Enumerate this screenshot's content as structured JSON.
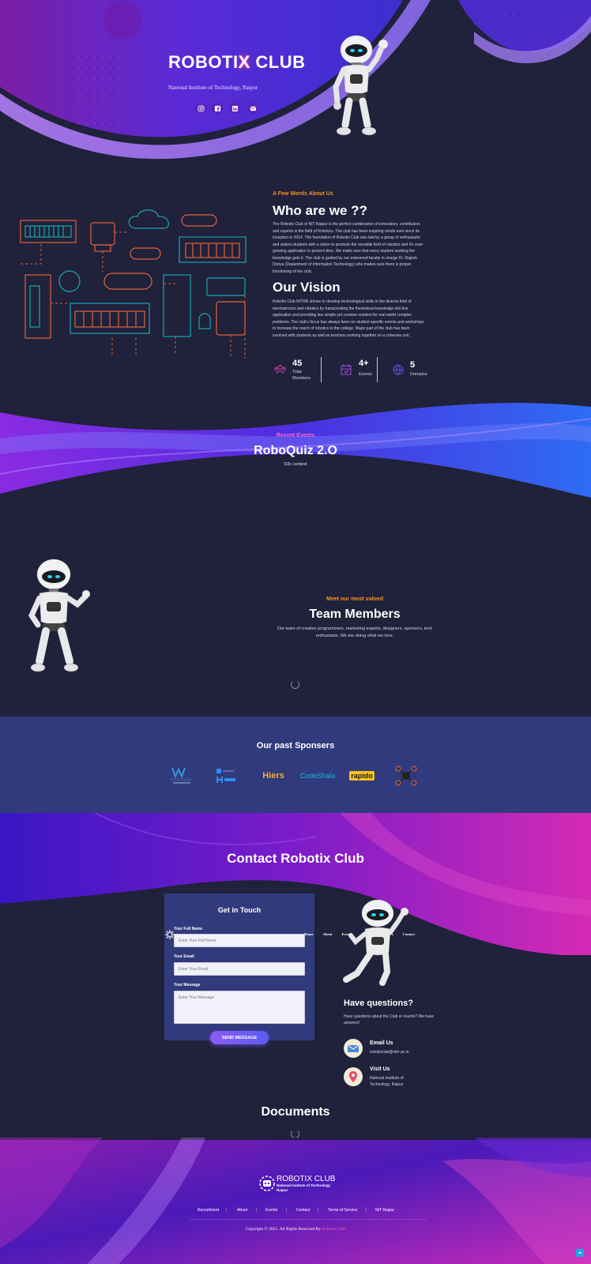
{
  "hero": {
    "title_prefix": "ROBOTI",
    "title_x": "X",
    "title_suffix": " CLUB",
    "subtitle": "National Institute of Technology, Raipur",
    "socials": [
      "instagram-icon",
      "facebook-icon",
      "linkedin-icon",
      "mail-icon"
    ]
  },
  "about": {
    "tag": "A Few Words About Us",
    "who_title": "Who are we ??",
    "who_text": "The Robotix Club of NIT Raipur is the perfect combination of innovators, contributors and experts in the field of Robotics. The club has been inspiring minds ever since its inception in 2014. The foundation of Robotix Club was laid by a group of enthusiastic and ardent students with a vision to promote the versatile field of robotics and it's ever-growing application in present time. We make sure that every student seeking the knowledge gets it. The club is guided by our esteemed faculty in charge Dr. Rajesh Doriya (Department of Information Technology) who makes sure there is proper functioning of the club.",
    "vision_title": "Our Vision",
    "vision_text": "Robotix Club NITRR strives to develop technological skills in the diverse field of mechatronics and robotics by transcending the theoretical knowledge into live application and providing live simple yet creative solution for real world complex problems. The club's focus has always been on student specific events and workshops to increase the reach of robotics in the college. Major part of the club has been involved with students as well as teachers working together so a cohesive unit.",
    "stats": [
      {
        "value": "45",
        "label_line1": "Total",
        "label_line2": "Members"
      },
      {
        "value": "4+",
        "label_line1": "Events",
        "label_line2": ""
      },
      {
        "value": "5",
        "label_line1": "Domains",
        "label_line2": ""
      }
    ]
  },
  "events": {
    "tag": "Recent Events",
    "title": "RoboQuiz 2.O",
    "subtitle": "D2c contest"
  },
  "team": {
    "tag": "Meet our most valued",
    "title": "Team Members",
    "text": "Our team of creative programmers, marketing experts, designers, sponsors, tech enthusiasts. We are doing what we love."
  },
  "sponsors": {
    "title": "Our past Sponsers",
    "logos": [
      "Wa",
      "Hoist",
      "Hiers",
      "CodeShala",
      "rapido",
      "Drone"
    ]
  },
  "contact": {
    "title": "Contact Robotix Club",
    "form_title": "Get in Touch",
    "name_label": "Your Full Name",
    "name_placeholder": "Enter Your Full Name",
    "email_label": "Your Email",
    "email_placeholder": "Enter Your Email",
    "message_label": "Your Message",
    "message_placeholder": "Enter Your Message",
    "send_label": "SEND MESSAGE",
    "overlay_nav": [
      "Home",
      "About",
      "Events",
      "Team",
      "Sponsors",
      "Contact"
    ],
    "questions_title": "Have questions?",
    "questions_text": "Have questions about the Club or events? We have answers!",
    "email_title": "Email Us",
    "email_value": "robotixclub@nitrr.ac.in",
    "visit_title": "Visit Us",
    "visit_line1": "National Institute of",
    "visit_line2": "Technology, Raipur"
  },
  "documents": {
    "title": "Documents"
  },
  "footer": {
    "brand": "ROBOTIX CLUB",
    "brand_sub1": "National Institute of Technology",
    "brand_sub2": "Raipur",
    "links": [
      "Recruitment",
      "About",
      "Events",
      "Contact",
      "Terms of Service",
      "NIT Raipur"
    ],
    "copyright_prefix": "Copyright © 2021. All Rights Reserved By ",
    "copyright_brand": "Robotix Club"
  },
  "colors": {
    "background": "#20213a",
    "accent_orange": "#f7931e",
    "accent_pink": "#ff6ad5",
    "sponsor_band": "#313a7c",
    "gradient_purple": "#7b2ff7",
    "gradient_magenta": "#d12bb3"
  }
}
